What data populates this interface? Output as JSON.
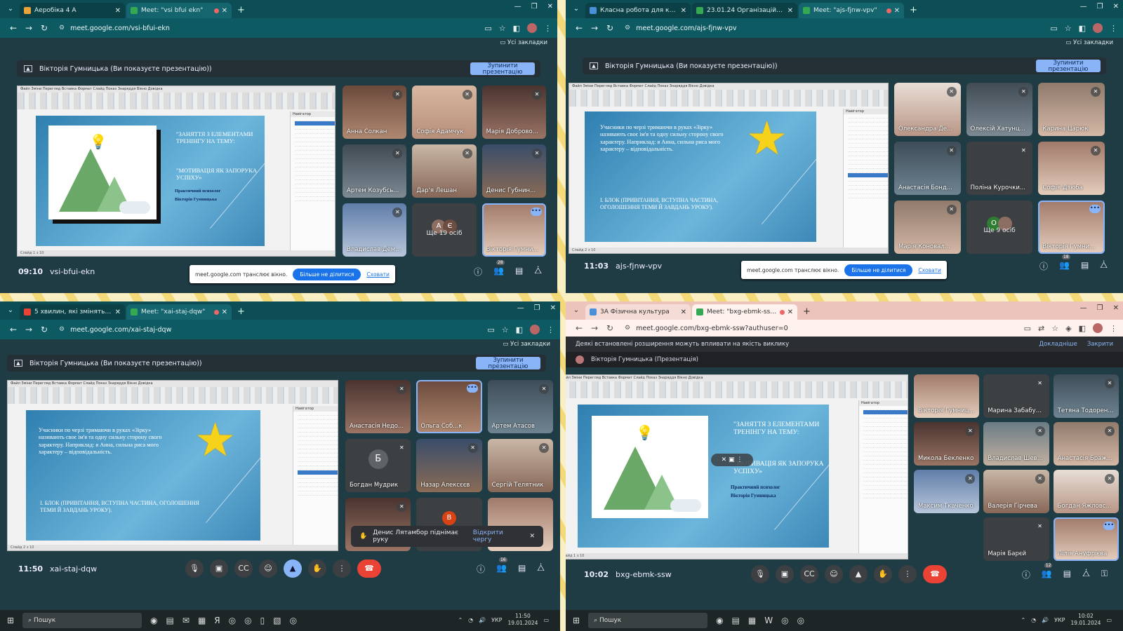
{
  "p1": {
    "tabs": [
      {
        "title": "Аеробіка 4 А",
        "fav": "#e8a33a"
      },
      {
        "title": "Meet: \"vsi bfui ekn\"",
        "fav": "#34a853"
      }
    ],
    "url": "meet.google.com/vsi-bfui-ekn",
    "bookmarks": "Усі закладки",
    "presenting": "Вікторія Гумницька (Ви показуєте презентацію))",
    "stop": "Зупинити презентацію",
    "slide_title": "\"ЗАНЯТТЯ З ЕЛЕМЕНТАМИ ТРЕНІНГУ НА ТЕМУ:",
    "slide_title2": "\"МОТИВАЦІЯ ЯК ЗАПОРУКА УСПІХУ»",
    "slide_sub": "Практичний психолог",
    "slide_sub2": "Вікторія Гумницька",
    "tiles": [
      {
        "name": "Анна Солкан",
        "c": "c1"
      },
      {
        "name": "Софія Адамчук",
        "c": "c2"
      },
      {
        "name": "Марія Доброво...",
        "c": "c3"
      },
      {
        "name": "Артем Козубсь...",
        "c": "c4"
      },
      {
        "name": "Дар'я Лешан",
        "c": "c5"
      },
      {
        "name": "Денис Губнин...",
        "c": "c6"
      },
      {
        "name": "Владислав Дем...",
        "c": "c7"
      }
    ],
    "more_label": "Ще 19 осіб",
    "more_initials": [
      "А",
      "Є"
    ],
    "self_name": "Вікторія Гумни...",
    "time": "09:10",
    "code": "vsi-bfui-ekn",
    "share_text": "meet.google.com транслює вікно.",
    "share_btn": "Більше не ділитися",
    "share_hide": "Сховати",
    "count": "28"
  },
  "p2": {
    "tabs": [
      {
        "title": "Класна робота для курсу \"Ф...",
        "fav": "#4a90d9"
      },
      {
        "title": "23.01.24 Організаційно-вихо...",
        "fav": "#34a853"
      },
      {
        "title": "Meet: \"ajs-fjnw-vpv\"",
        "fav": "#34a853"
      }
    ],
    "url": "meet.google.com/ajs-fjnw-vpv",
    "bookmarks": "Усі закладки",
    "presenting": "Вікторія Гумницька (Ви показуєте презентацію))",
    "stop": "Зупинити презентацію",
    "slide_text": "Учасники по черзі тримаючи в руках «Зірку» називають своє ім'я та одну сильну сторону свого характеру. Наприклад: я Анна, сильна риса мого характеру – відповідальність.",
    "slide_block": "І. БЛОК (ПРИВІТАННЯ, ВСТУПНА ЧАСТИНА, ОГОЛОШЕННЯ ТЕМИ Й ЗАВДАНЬ УРОКУ).",
    "tiles": [
      {
        "name": "Олександра Де...",
        "c": "c8"
      },
      {
        "name": "Олексій Хатунц...",
        "c": "c4"
      },
      {
        "name": "Карина Царюк",
        "c": "c9"
      },
      {
        "name": "Анастасія Бонд...",
        "c": "c10"
      },
      {
        "name": "Поліна Курочки...",
        "c": "c11"
      },
      {
        "name": "Софія Дзюба",
        "c": "c12"
      },
      {
        "name": "Марія Коновал...",
        "c": "c9"
      }
    ],
    "more_label": "Ще 9 осіб",
    "more_initials": [
      "О",
      ""
    ],
    "self_name": "Вікторія Гумни...",
    "time": "11:03",
    "code": "ajs-fjnw-vpv",
    "share_text": "meet.google.com транслює вікно.",
    "share_btn": "Більше не ділитися",
    "share_hide": "Сховати",
    "count": "18"
  },
  "p3": {
    "tabs": [
      {
        "title": "5 хвилин, які змінять твоє жит...",
        "fav": "#ea4335"
      },
      {
        "title": "Meet: \"xai-staj-dqw\"",
        "fav": "#34a853"
      }
    ],
    "url": "meet.google.com/xai-staj-dqw",
    "bookmarks": "Усі закладки",
    "presenting": "Вікторія Гумницька (Ви показуєте презентацію))",
    "stop": "Зупинити презентацію",
    "slide_text": "Учасники по черзі тримаючи в руках «Зірку» називають своє ім'я та одну сильну сторону свого характеру. Наприклад: я Анна, сильна риса мого характеру – відповідальність.",
    "slide_block": "І. БЛОК (ПРИВІТАННЯ, ВСТУПНА ЧАСТИНА, ОГОЛОШЕННЯ ТЕМИ Й ЗАВДАНЬ УРОКУ).",
    "tiles": [
      {
        "name": "Анастасія Недо...",
        "c": "c3"
      },
      {
        "name": "Ольга Соб...к",
        "c": "c1"
      },
      {
        "name": "Артем Атасов",
        "c": "c10"
      },
      {
        "name": "Богдан Мудрик",
        "c": "dark",
        "initial": "Б",
        "ic": "#5f6368"
      },
      {
        "name": "Назар Алексєєв",
        "c": "c6"
      },
      {
        "name": "Сергій Телятник",
        "c": "c5"
      }
    ],
    "toast": "Денис Лятамбор піднімає руку",
    "toast_link": "Відкрити чергу",
    "time": "11:50",
    "code": "xai-staj-dqw",
    "count": "16",
    "task_search": "Пошук",
    "task_lang": "УКР",
    "task_time": "11:50",
    "task_date": "19.01.2024"
  },
  "p4": {
    "tabs": [
      {
        "title": "3А Фізична культура",
        "fav": "#4a90d9"
      },
      {
        "title": "Meet: \"bxg-ebmk-ssw\"",
        "fav": "#34a853"
      }
    ],
    "url": "meet.google.com/bxg-ebmk-ssw?authuser=0",
    "info": "Деякі встановлені розширення можуть впливати на якість виклику",
    "info_more": "Докладніше",
    "info_close": "Закрити",
    "presenting": "Вікторія Гумницька (Презентація)",
    "slide_title": "\"ЗАНЯТТЯ З ЕЛЕМЕНТАМИ ТРЕНІНГУ НА ТЕМУ:",
    "slide_title2": "\"МОТИВАЦІЯ ЯК ЗАПОРУКА УСПІХУ»",
    "slide_sub": "Практичний психолог",
    "slide_sub2": "Вікторія Гумницька",
    "tiles": [
      {
        "name": "Вікторія Гумниць...",
        "c": "c12"
      },
      {
        "name": "Марина Забабур...",
        "c": "dark"
      },
      {
        "name": "Тетяна Тодоренко",
        "c": "c10"
      },
      {
        "name": "Микола Бекленко",
        "c": "c3"
      },
      {
        "name": "Владислав Шевч...",
        "c": "c11"
      },
      {
        "name": "Анастасія Браж...",
        "c": "c9"
      },
      {
        "name": "Максим Ткаченко",
        "c": "c7"
      },
      {
        "name": "Валерія Гірчева",
        "c": "c5"
      },
      {
        "name": "Богдан Яжловсь...",
        "c": "c8"
      },
      {
        "name": "Марія Барєй",
        "c": "dark"
      },
      {
        "name": "Лілія Ануфрієва",
        "c": "c12"
      }
    ],
    "time": "10:02",
    "code": "bxg-ebmk-ssw",
    "count": "12",
    "task_search": "Пошук",
    "task_lang": "УКР",
    "task_time": "10:02",
    "task_date": "19.01.2024"
  },
  "slide_menu": "Файл  Зміни  Перегляд  Вставка  Формат  Слайд  Показ  Знаряддя  Вікно  Довідка",
  "nav_title": "Навігатор"
}
